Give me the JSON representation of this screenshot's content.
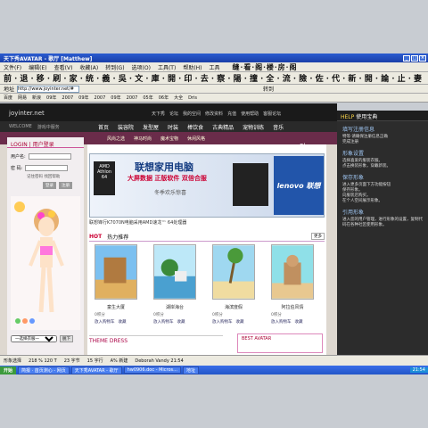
{
  "window": {
    "title": "天下秀AVATAR - 歌厅 [Matthew]"
  },
  "menubar": {
    "items": [
      "文件(F)",
      "编辑(E)",
      "查看(V)",
      "收藏(A)",
      "转到(G)",
      "选项(O)",
      "工具(T)",
      "帮助(H)",
      "工具"
    ],
    "fancy": "缝·看·阁·楼·房·阁"
  },
  "toolbar": {
    "text": "前 · 退 · 移 · 刷 · 家 · 统 · 義 · 吳 · 文 · 庫 · 開 · 印 · 去 · 察 · 陽 · 撞 · 全 · 流 · 險 · 佐 · 代 · 新 · 開 · 論 · 止 · 妻"
  },
  "address": {
    "label": "地址",
    "value": "http://www.joyinter.net/#",
    "go": "转到"
  },
  "links": [
    "百度",
    "网易",
    "新浪",
    "09年",
    "2007",
    "09年",
    "2007",
    "09年",
    "2007",
    "05年",
    "06年",
    "大全",
    "Dris"
  ],
  "site": {
    "logo": "joyinter.net",
    "toplinks": [
      "天下秀",
      "论坛",
      "我的空间",
      "修改资料",
      "充值",
      "使用帮助",
      "客服论坛"
    ],
    "userbar": [
      "WELCOME",
      "游戏中服务"
    ],
    "nav": [
      "首页",
      "装容院",
      "发型屋",
      "时装",
      "棒饮食",
      "古典精品",
      "宠物训练",
      "音乐"
    ],
    "subnav": [
      "风尚之选",
      "神马时尚",
      "魔术宝物",
      "休闲风格"
    ]
  },
  "login": {
    "title": "LOGIN | 用户登录",
    "user_label": "用户名:",
    "pass_label": "密   码:",
    "remember": "记住密码",
    "help": "找回帮助",
    "login_btn": "登录",
    "register_btn": "注册"
  },
  "wardrobe": {
    "select": "一选择衣服一",
    "button": "脱下"
  },
  "show_label": "Show",
  "banner": {
    "h1": "联想家用电脑",
    "h2": "大屏数据 正版软件 双倍合服",
    "h3": "冬季欢乐惊喜",
    "brand": "lenovo 联想",
    "amd": "AMD Athlon 64",
    "caption": "联想锋行K7070N电脑采用AMD速龙™ 64处理器"
  },
  "hot": {
    "tab_hot": "HOT",
    "tab_sub": "热力推荐",
    "more": "更多"
  },
  "cards": [
    {
      "name": "童生大厦",
      "points": "0积分",
      "acts": [
        "放入购物车",
        "收藏"
      ]
    },
    {
      "name": "湖岸海台",
      "points": "0积分",
      "acts": [
        "放入购物车",
        "收藏"
      ]
    },
    {
      "name": "海滨度假",
      "points": "0积分",
      "acts": [
        "放入购物车",
        "收藏"
      ]
    },
    {
      "name": "阿拉伯风情",
      "points": "0积分",
      "acts": [
        "放入购物车",
        "收藏"
      ]
    }
  ],
  "theme": {
    "label": "THEME DRESS"
  },
  "best": {
    "label": "BEST AVATAR"
  },
  "help": {
    "head_a": "HELP",
    "head_b": "使用宝典",
    "sections": [
      {
        "title": "填写注册信息",
        "lines": [
          "特等·请确保注册信息正确",
          "完成注册"
        ]
      },
      {
        "title": "形象设置",
        "lines": [
          "选择喜爱的服装衣服。",
          "点击换装形象，穿戴新装。"
        ]
      },
      {
        "title": "保存形象",
        "lines": [
          "进入更多页面下方功能按钮",
          "保存形象。",
          "向服装店购买。",
          "在个人空间展示形象。"
        ]
      },
      {
        "title": "引用形象",
        "lines": [
          "进入您的用户管理，进行形象的设置，复制代码在各种社区使用形象。"
        ]
      }
    ]
  },
  "status": {
    "left": "形象选择",
    "items": [
      "218 % 120 T",
      "23 字节",
      "15 字行",
      "A% 新建",
      "Deborah Vandy 21:54"
    ]
  },
  "taskbar": {
    "start": "开始",
    "tasks": [
      "简报 · 首页测心 - 网页",
      "天下秀AVATAR - 歌厅",
      "hw0906.doc - Micros...",
      "地址"
    ],
    "tray": "21:54"
  },
  "colors": {
    "accent": "#1a3fa8",
    "site_dark": "#1a1a1a",
    "subnav": "#6a2c4a",
    "help_bg": "#2c2c2c"
  }
}
